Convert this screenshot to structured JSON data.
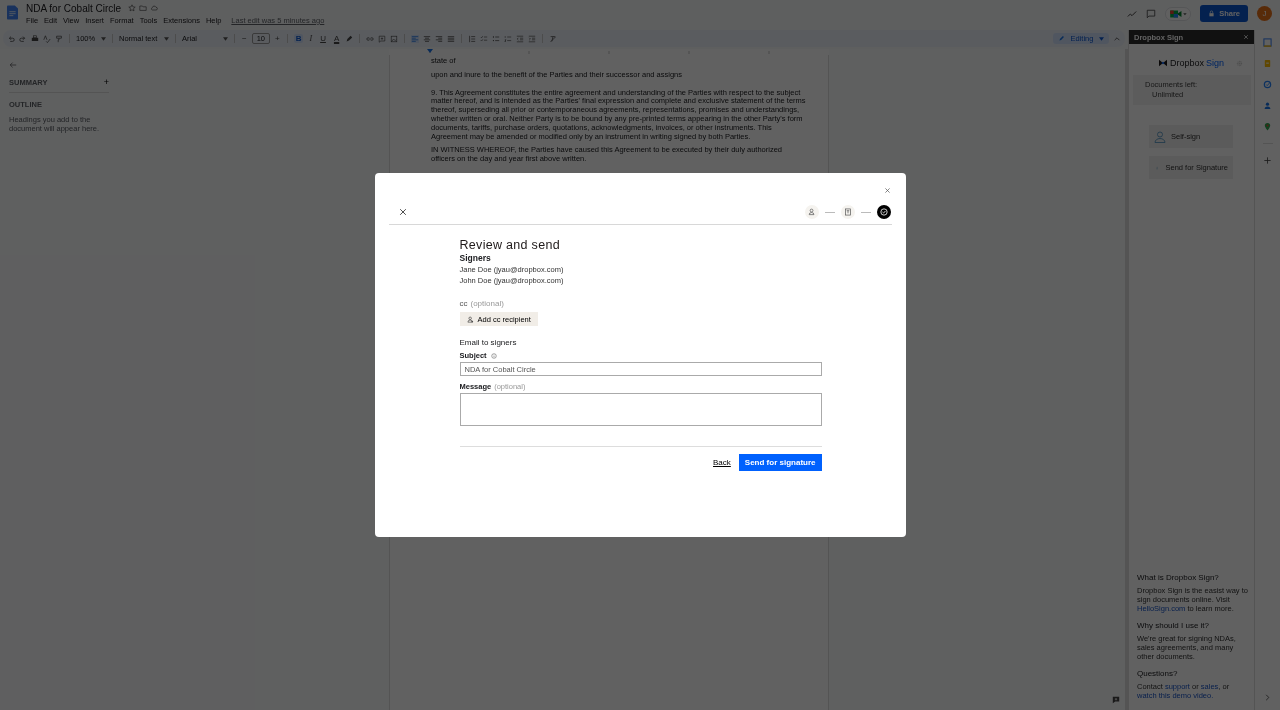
{
  "docs": {
    "title": "NDA for Cobalt Circle",
    "menu": [
      "File",
      "Edit",
      "View",
      "Insert",
      "Format",
      "Tools",
      "Extensions",
      "Help"
    ],
    "last_edit": "Last edit was 5 minutes ago",
    "share": "Share",
    "avatar": "J"
  },
  "toolbar": {
    "zoom": "100%",
    "style": "Normal text",
    "font": "Arial",
    "size_minus": "−",
    "font_size": "10",
    "size_plus": "+",
    "format_buttons": [
      {
        "label": "B",
        "selected": true
      },
      {
        "label": "I",
        "selected": false
      },
      {
        "label": "U",
        "selected": false
      },
      {
        "label": "A",
        "selected": false
      }
    ],
    "alignments": [
      {
        "selected": true
      },
      {
        "selected": false
      },
      {
        "selected": false
      },
      {
        "selected": false
      }
    ],
    "mode": "Editing"
  },
  "outline_panel": {
    "summary": "SUMMARY",
    "add": "+",
    "outline": "OUTLINE",
    "hint": "Headings you add to the document will appear here."
  },
  "document": {
    "paragraphs": [
      "state of",
      "upon and inure to the benefit of the Parties and their successor and assigns",
      "9. This Agreement constitutes the entire agreement and understanding of the Parties with respect to the subject matter hereof, and is intended as the Parties' final expression and complete and exclusive statement of the terms thereof, superseding all prior or contemporaneous agreements, representations, promises and understandings, whether written or oral. Neither Party is to be bound by any pre-printed terms appearing in the other Party's form documents, tariffs, purchase orders, quotations, acknowledgments, invoices, or other instruments. This Agreement may be amended or modified only by an instrument in writing signed by both Parties.",
      "IN WITNESS WHEREOF, the Parties have caused this Agreement to be executed by their duly authorized officers on the day and year first above written."
    ]
  },
  "addon_panel": {
    "title": "Dropbox Sign",
    "logo_word": "Dropbox",
    "logo_accent": "Sign",
    "documents_label": "Documents left:",
    "documents_value": "Unlimited",
    "actions": [
      {
        "kind": "self",
        "label": "Self-sign"
      },
      {
        "kind": "send",
        "label": "Send for Signature"
      }
    ],
    "info": [
      {
        "heading": "What is Dropbox Sign?",
        "parts": [
          {
            "text": "Dropbox Sign is the easist way to sign documents online. Visit ",
            "link": false
          },
          {
            "text": "HelloSign.com",
            "link": true
          },
          {
            "text": " to learn more.",
            "link": false
          }
        ]
      },
      {
        "heading": "Why should I use it?",
        "parts": [
          {
            "text": "We're great for signing NDAs, sales agreements, and many other documents.",
            "link": false
          }
        ]
      },
      {
        "heading": "Questions?",
        "parts": [
          {
            "text": "Contact ",
            "link": false
          },
          {
            "text": "support",
            "link": true
          },
          {
            "text": " or ",
            "link": false
          },
          {
            "text": "sales",
            "link": true
          },
          {
            "text": ", or ",
            "link": false
          },
          {
            "text": "watch this demo video.",
            "link": true
          }
        ]
      }
    ]
  },
  "modal": {
    "steps": [
      {
        "kind": "signers",
        "selected": false
      },
      {
        "kind": "fields",
        "selected": false
      },
      {
        "kind": "review",
        "selected": true
      }
    ],
    "title": "Review and send",
    "signers_heading": "Signers",
    "signers": [
      "Jane Doe (jyau@dropbox.com)",
      "John Doe (jyau@dropbox.com)"
    ],
    "cc_label": "cc",
    "cc_optional": "(optional)",
    "add_cc": "Add cc recipient",
    "email_heading": "Email to signers",
    "subject_label": "Subject",
    "subject_value": "NDA for Cobalt Circle",
    "message_label": "Message",
    "message_optional": "(optional)",
    "back": "Back",
    "send": "Send for signature"
  }
}
